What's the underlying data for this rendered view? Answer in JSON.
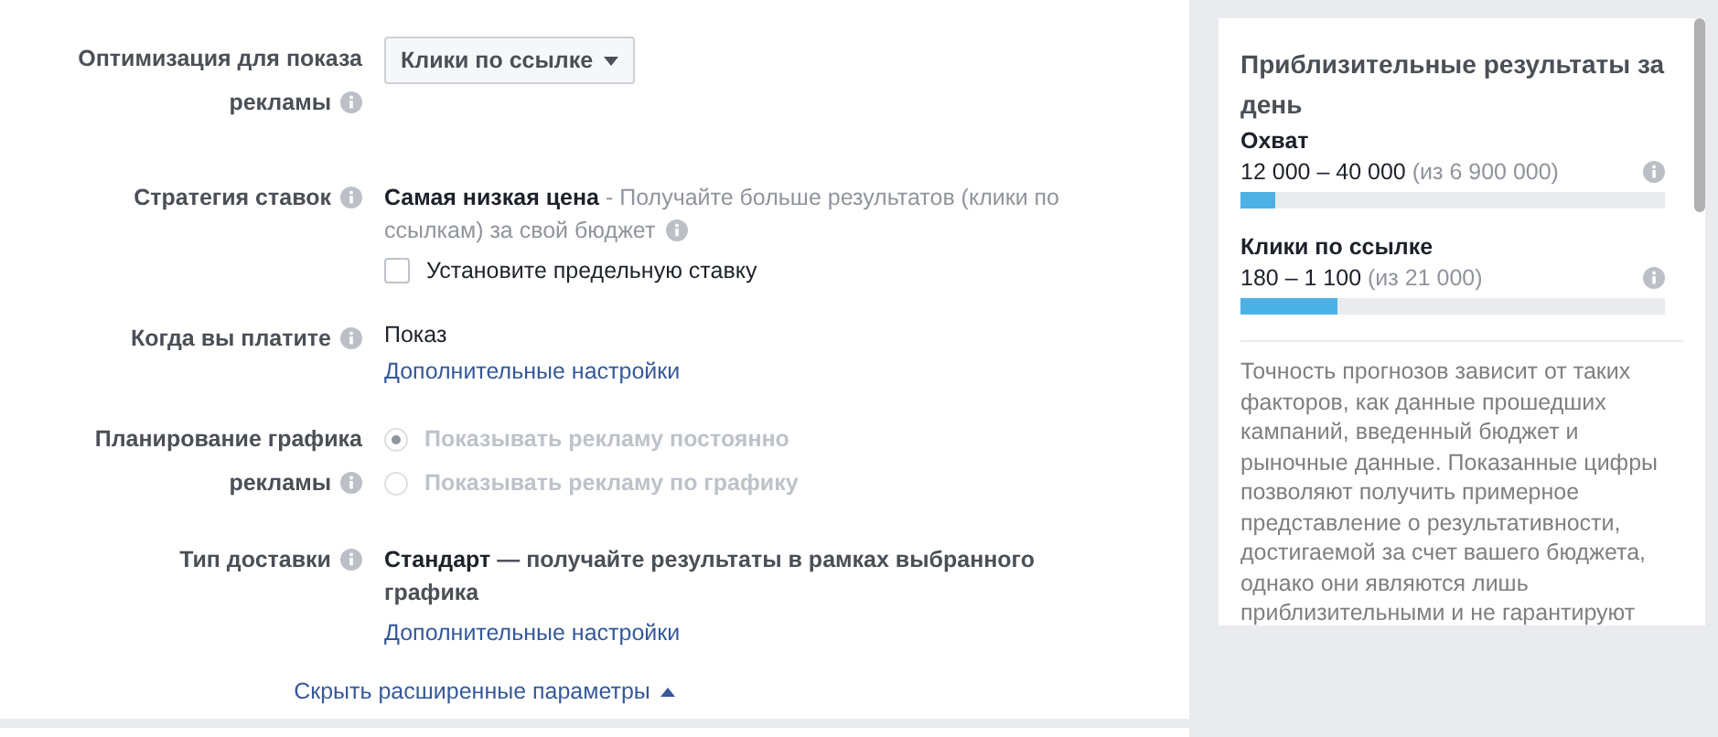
{
  "settings": [
    {
      "kind": "dropdown",
      "label": [
        "Оптимизация для показа",
        "рекламы"
      ],
      "value": "Клики по ссылке"
    },
    {
      "kind": "strategy",
      "label": [
        "Стратегия ставок"
      ],
      "title": "Самая низкая цена",
      "description": " - Получайте больше результатов (клики по ссылкам) за свой бюджет",
      "checkbox": {
        "label": "Установите предельную ставку",
        "checked": false
      }
    },
    {
      "kind": "text",
      "label": [
        "Когда вы платите"
      ],
      "value": "Показ",
      "link": "Дополнительные настройки"
    },
    {
      "kind": "radios",
      "label": [
        "Планирование графика",
        "рекламы"
      ],
      "options": [
        {
          "label": "Показывать рекламу постоянно",
          "selected": true,
          "disabled": true
        },
        {
          "label": "Показывать рекламу по графику",
          "selected": false,
          "disabled": true
        }
      ]
    },
    {
      "kind": "delivery",
      "label": [
        "Тип доставки"
      ],
      "title": "Стандарт",
      "description": " — получайте результаты в рамках выбранного графика",
      "link": "Дополнительные настройки"
    }
  ],
  "toggle_link": "Скрыть расширенные параметры",
  "estimate": {
    "title": "Приблизительные результаты за день",
    "metrics": [
      {
        "name": "Охват",
        "range": "12 000 – 40 000",
        "total": "(из 6 900 000)",
        "level": 0.08
      },
      {
        "name": "Клики по ссылке",
        "range": "180 – 1 100",
        "total": "(из 21 000)",
        "level": 0.23
      }
    ],
    "note": "Точность прогнозов зависит от таких факторов, как данные прошедших кампаний, введенный бюджет и рыночные данные. Показанные цифры позволяют получить примерное представление о результативности, достигаемой за счет вашего бюджета, однако они являются лишь приблизительными и не гарантируют"
  }
}
